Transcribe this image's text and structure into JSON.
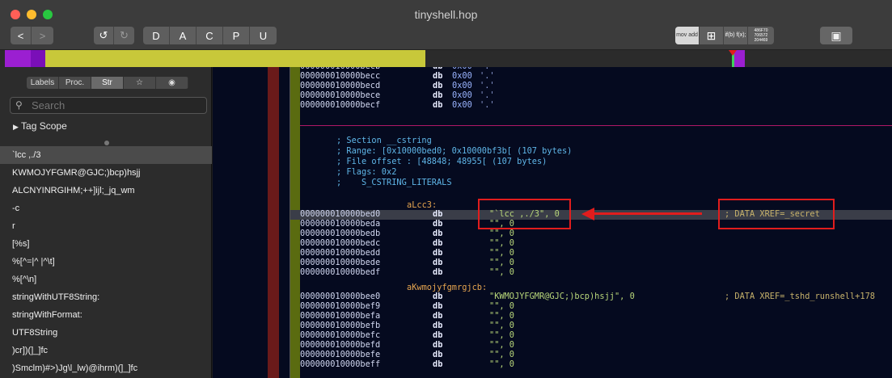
{
  "window": {
    "title": "tinyshell.hop",
    "nav_back": "<",
    "nav_forward": ">",
    "undo": "↺",
    "redo": "↻",
    "mode_buttons": [
      "D",
      "A",
      "C",
      "P",
      "U"
    ],
    "view_buttons": [
      "mov add",
      "⊞",
      "if(b) f(x);",
      "486F70 706572 204469",
      "▣"
    ]
  },
  "sidebar": {
    "tabs": [
      "Labels",
      "Proc.",
      "Str",
      "☆",
      "◉"
    ],
    "search_placeholder": "Search",
    "tag_scope": "Tag Scope",
    "strings": [
      "`lcc ,./3",
      "KWMOJYFGMR@GJC;)bcp)hsjj",
      "ALCNYINRGIHM;++]ijl;_jq_wm",
      "-c",
      "r",
      "[%s]",
      "%[^=|^ |^\\t]",
      "%[^\\n]",
      "stringWithUTF8String:",
      "stringWithFormat:",
      "UTF8String",
      ")cr])(]_]fc",
      ")Smclm)#>)Jg\\l_lw)@ihrm)(]_]fc"
    ]
  },
  "code": {
    "top_rows": [
      {
        "addr": "000000010000becb",
        "op": "db",
        "arg": "0x00",
        "cmt": "'.'"
      },
      {
        "addr": "000000010000becc",
        "op": "db",
        "arg": "0x00",
        "cmt": "'.'"
      },
      {
        "addr": "000000010000becd",
        "op": "db",
        "arg": "0x00",
        "cmt": "'.'"
      },
      {
        "addr": "000000010000bece",
        "op": "db",
        "arg": "0x00",
        "cmt": "'.'"
      },
      {
        "addr": "000000010000becf",
        "op": "db",
        "arg": "0x00",
        "cmt": "'.'"
      }
    ],
    "section_lines": [
      "; Section __cstring",
      "; Range: [0x10000bed0; 0x10000bf3b[ (107 bytes)",
      "; File offset : [48848; 48955[ (107 bytes)",
      "; Flags: 0x2",
      ";    S_CSTRING_LITERALS"
    ],
    "label1": "aLcc3:",
    "block1": [
      {
        "addr": "000000010000bed0",
        "op": "db",
        "arg": "\"`lcc ,./3\", 0",
        "xref": "; DATA XREF=_secret"
      },
      {
        "addr": "000000010000beda",
        "op": "db",
        "arg": "\"\", 0",
        "xref": ""
      },
      {
        "addr": "000000010000bedb",
        "op": "db",
        "arg": "\"\", 0",
        "xref": ""
      },
      {
        "addr": "000000010000bedc",
        "op": "db",
        "arg": "\"\", 0",
        "xref": ""
      },
      {
        "addr": "000000010000bedd",
        "op": "db",
        "arg": "\"\", 0",
        "xref": ""
      },
      {
        "addr": "000000010000bede",
        "op": "db",
        "arg": "\"\", 0",
        "xref": ""
      },
      {
        "addr": "000000010000bedf",
        "op": "db",
        "arg": "\"\", 0",
        "xref": ""
      }
    ],
    "label2": "aKwmojyfgmrgjcb:",
    "block2": [
      {
        "addr": "000000010000bee0",
        "op": "db",
        "arg": "\"KWMOJYFGMR@GJC;)bcp)hsjj\", 0",
        "xref": "; DATA XREF=_tshd_runshell+178"
      },
      {
        "addr": "000000010000bef9",
        "op": "db",
        "arg": "\"\", 0",
        "xref": ""
      },
      {
        "addr": "000000010000befa",
        "op": "db",
        "arg": "\"\", 0",
        "xref": ""
      },
      {
        "addr": "000000010000befb",
        "op": "db",
        "arg": "\"\", 0",
        "xref": ""
      },
      {
        "addr": "000000010000befc",
        "op": "db",
        "arg": "\"\", 0",
        "xref": ""
      },
      {
        "addr": "000000010000befd",
        "op": "db",
        "arg": "\"\", 0",
        "xref": ""
      },
      {
        "addr": "000000010000befe",
        "op": "db",
        "arg": "\"\", 0",
        "xref": ""
      },
      {
        "addr": "000000010000beff",
        "op": "db",
        "arg": "\"\", 0",
        "xref": ""
      }
    ]
  },
  "colors": {
    "accent_red": "#e11d1d",
    "nav_yellow": "#c8c83a",
    "nav_purple": "#9b1fd1"
  }
}
